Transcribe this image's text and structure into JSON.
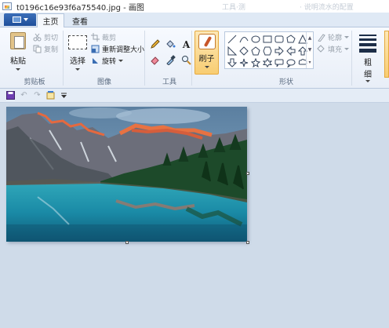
{
  "window": {
    "title": "t0196c16e93f6a75540.jpg - 画图",
    "background_right_text": "工具·测",
    "background_right_text2": "· 说明流水的配置"
  },
  "tabs": {
    "home": "主页",
    "view": "查看"
  },
  "clipboard": {
    "paste": "粘贴",
    "cut": "剪切",
    "copy": "复制",
    "label": "剪贴板"
  },
  "image": {
    "select": "选择",
    "crop": "裁剪",
    "resize": "重新调整大小",
    "rotate": "旋转",
    "label": "图像"
  },
  "tools": {
    "label": "工具"
  },
  "brush": {
    "label": "刷子"
  },
  "shapes": {
    "outline": "轮廓",
    "fill": "填充",
    "label": "形状"
  },
  "size": {
    "label_line1": "粗",
    "label_line2": "细"
  },
  "colors": {
    "accent": "#f8cd72",
    "ribbon_bg": "#f0f5fb",
    "workspace_bg": "#cfdbe9",
    "file_tab": "#2a5ca8"
  }
}
